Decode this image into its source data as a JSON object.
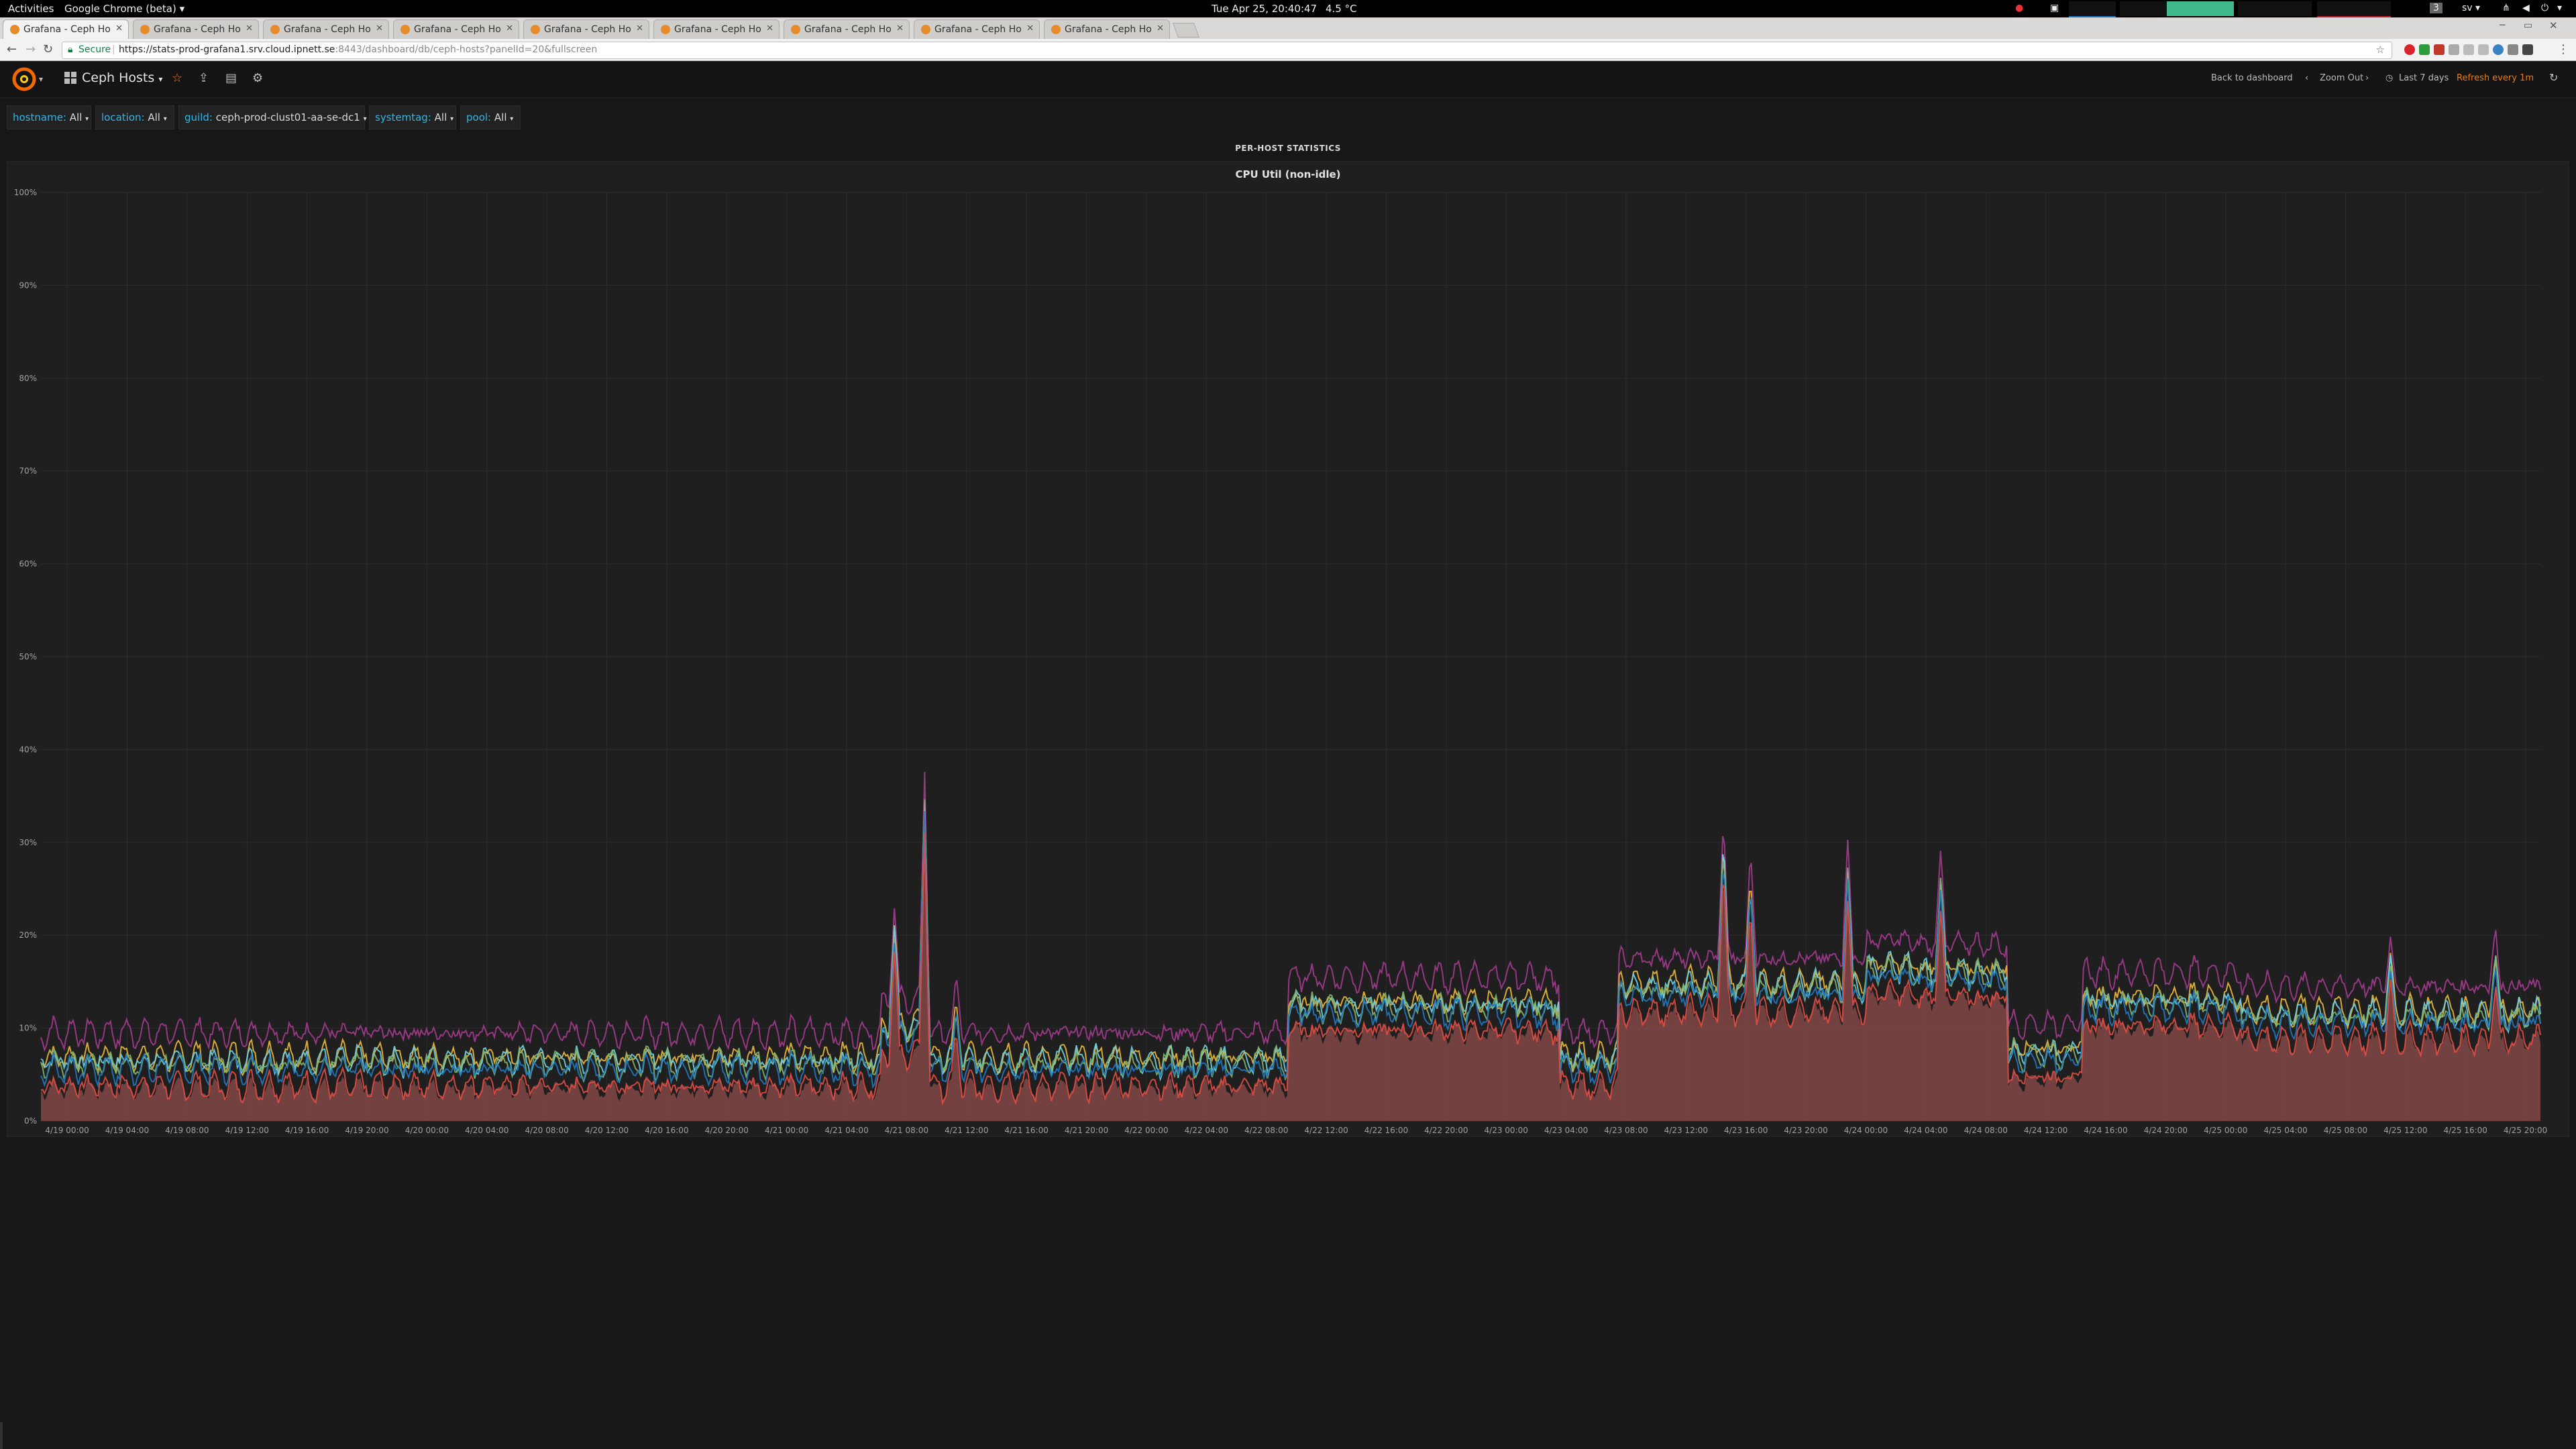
{
  "gnome": {
    "activities": "Activities",
    "app_menu": "Google Chrome (beta) ▾",
    "clock": "Tue Apr 25, 20:40:47",
    "weather": "4.5 °C",
    "keyboard": "sv ▾",
    "workspace": "3"
  },
  "browser": {
    "tabs": [
      {
        "title": "Grafana - Ceph Hosts",
        "active": true
      },
      {
        "title": "Grafana - Ceph Hosts"
      },
      {
        "title": "Grafana - Ceph Hosts"
      },
      {
        "title": "Grafana - Ceph Hosts"
      },
      {
        "title": "Grafana - Ceph Hosts"
      },
      {
        "title": "Grafana - Ceph Hosts"
      },
      {
        "title": "Grafana - Ceph Hosts"
      },
      {
        "title": "Grafana - Ceph Hosts"
      },
      {
        "title": "Grafana - Ceph Hosts"
      }
    ],
    "secure_label": "Secure",
    "url_main": "https://stats-prod-grafana1.srv.cloud.ipnett.se",
    "url_rest": ":8443/dashboard/db/ceph-hosts?panelId=20&fullscreen"
  },
  "grafana": {
    "dashboard_title": "Ceph Hosts",
    "back_to_dashboard": "Back to dashboard",
    "zoom_out": "Zoom Out",
    "time_range": "Last 7 days",
    "refresh": "Refresh every 1m",
    "variables": [
      {
        "label": "hostname:",
        "value": "All"
      },
      {
        "label": "location:",
        "value": "All"
      },
      {
        "label": "guild:",
        "value": "ceph-prod-clust01-aa-se-dc1"
      },
      {
        "label": "systemtag:",
        "value": "All"
      },
      {
        "label": "pool:",
        "value": "All"
      }
    ],
    "row_title": "PER-HOST STATISTICS",
    "panel_title": "CPU Util (non-idle)"
  },
  "colors": {
    "accent": "#eb7b18",
    "var_label": "#33b5e5",
    "purple": "#a23b8d",
    "fill": "#8f4d4b"
  },
  "chart_data": {
    "type": "area",
    "title": "CPU Util (non-idle)",
    "y_ticks": [
      "0%",
      "10%",
      "20%",
      "30%",
      "40%",
      "50%",
      "60%",
      "70%",
      "80%",
      "90%",
      "100%"
    ],
    "ylim": [
      0,
      100
    ],
    "x_ticks": [
      "4/19 00:00",
      "4/19 04:00",
      "4/19 08:00",
      "4/19 12:00",
      "4/19 16:00",
      "4/19 20:00",
      "4/20 00:00",
      "4/20 04:00",
      "4/20 08:00",
      "4/20 12:00",
      "4/20 16:00",
      "4/20 20:00",
      "4/21 00:00",
      "4/21 04:00",
      "4/21 08:00",
      "4/21 12:00",
      "4/21 16:00",
      "4/21 20:00",
      "4/22 00:00",
      "4/22 04:00",
      "4/22 08:00",
      "4/22 12:00",
      "4/22 16:00",
      "4/22 20:00",
      "4/23 00:00",
      "4/23 04:00",
      "4/23 08:00",
      "4/23 12:00",
      "4/23 16:00",
      "4/23 20:00",
      "4/24 00:00",
      "4/24 04:00",
      "4/24 08:00",
      "4/24 12:00",
      "4/24 16:00",
      "4/24 20:00",
      "4/25 00:00",
      "4/25 04:00",
      "4/25 08:00",
      "4/25 12:00",
      "4/25 16:00",
      "4/25 20:00"
    ],
    "x_range_hours": [
      -1.75,
      165.0
    ],
    "grid": true,
    "segments": [
      {
        "start": -1.75,
        "end": 54.3,
        "base": 6.0,
        "top": 9.5
      },
      {
        "start": 54.3,
        "end": 57.0,
        "base": 9.5,
        "top": 12.0
      },
      {
        "start": 57.0,
        "end": 81.5,
        "base": 6.0,
        "top": 9.5
      },
      {
        "start": 81.5,
        "end": 99.5,
        "base": 12.0,
        "top": 15.5
      },
      {
        "start": 99.5,
        "end": 103.5,
        "base": 6.0,
        "top": 9.5
      },
      {
        "start": 103.5,
        "end": 120.0,
        "base": 14.0,
        "top": 17.0
      },
      {
        "start": 120.0,
        "end": 123.0,
        "base": 16.0,
        "top": 19.5
      },
      {
        "start": 123.0,
        "end": 129.5,
        "base": 15.5,
        "top": 18.5
      },
      {
        "start": 129.5,
        "end": 134.5,
        "base": 7.0,
        "top": 9.5
      },
      {
        "start": 134.5,
        "end": 145.0,
        "base": 12.5,
        "top": 15.0
      },
      {
        "start": 145.0,
        "end": 165.0,
        "base": 11.0,
        "top": 13.5
      }
    ],
    "spikes": [
      {
        "hours": 55.2,
        "value": 20.5
      },
      {
        "hours": 57.2,
        "value": 34.5
      },
      {
        "hours": 59.3,
        "value": 12.0
      },
      {
        "hours": 110.5,
        "value": 30.0
      },
      {
        "hours": 112.3,
        "value": 25.5
      },
      {
        "hours": 118.8,
        "value": 27.0
      },
      {
        "hours": 125.0,
        "value": 26.0
      },
      {
        "hours": 155.0,
        "value": 17.0
      },
      {
        "hours": 162.0,
        "value": 17.5
      }
    ],
    "series": [
      {
        "color": "#a23b8d",
        "offset": 3.5
      },
      {
        "color": "#eab839",
        "offset": 0.9
      },
      {
        "color": "#6ed0e0",
        "offset": 0.5
      },
      {
        "color": "#7eb26d",
        "offset": 0.2
      },
      {
        "color": "#1f78c1",
        "offset": -0.4
      },
      {
        "color": "#e24d42",
        "offset": -2.2
      }
    ]
  }
}
